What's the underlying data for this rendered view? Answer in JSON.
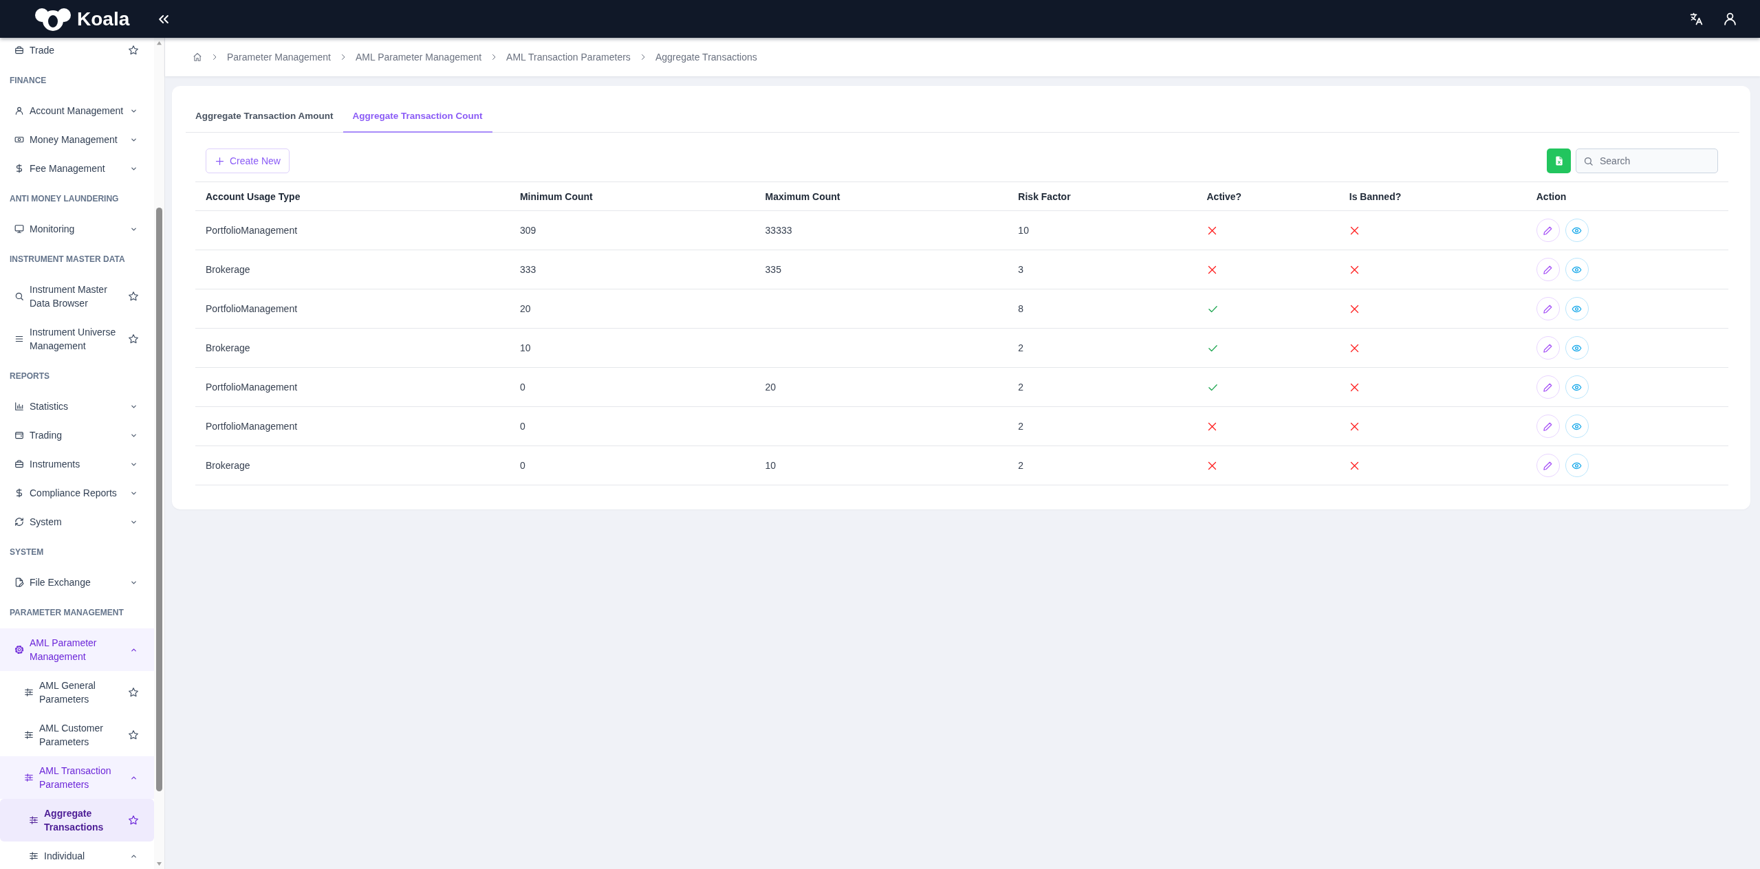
{
  "header": {
    "logo_text": "Koala"
  },
  "sidebar": {
    "entries": [
      {
        "kind": "link",
        "label": "Trade",
        "selected": false,
        "starred": false
      },
      {
        "kind": "heading",
        "label": "FINANCE"
      },
      {
        "kind": "menu",
        "label": "Account Management",
        "selected": false,
        "expanded": false
      },
      {
        "kind": "menu",
        "label": "Money Management",
        "selected": false,
        "expanded": false
      },
      {
        "kind": "menu",
        "label": "Fee Management",
        "selected": false,
        "expanded": false
      },
      {
        "kind": "heading",
        "label": "ANTI MONEY LAUNDERING"
      },
      {
        "kind": "menu",
        "label": "Monitoring",
        "selected": false,
        "expanded": false
      },
      {
        "kind": "heading",
        "label": "INSTRUMENT MASTER DATA"
      },
      {
        "kind": "link",
        "label": "Instrument Master Data Browser",
        "selected": false,
        "starred": false
      },
      {
        "kind": "link",
        "label": "Instrument Universe Management",
        "selected": false,
        "starred": false
      },
      {
        "kind": "heading",
        "label": "REPORTS"
      },
      {
        "kind": "menu",
        "label": "Statistics",
        "selected": false,
        "expanded": false
      },
      {
        "kind": "menu",
        "label": "Trading",
        "selected": false,
        "expanded": false
      },
      {
        "kind": "menu",
        "label": "Instruments",
        "selected": false,
        "expanded": false
      },
      {
        "kind": "menu",
        "label": "Compliance Reports",
        "selected": false,
        "expanded": false
      },
      {
        "kind": "menu",
        "label": "System",
        "selected": false,
        "expanded": false
      },
      {
        "kind": "heading",
        "label": "SYSTEM"
      },
      {
        "kind": "menu",
        "label": "File Exchange",
        "selected": false,
        "expanded": false
      },
      {
        "kind": "heading",
        "label": "PARAMETER MANAGEMENT"
      },
      {
        "kind": "menu",
        "label": "AML Parameter Management",
        "selected": false,
        "expanded": true,
        "children": [
          {
            "kind": "link",
            "label": "AML General Parameters",
            "selected": false,
            "starred": false
          },
          {
            "kind": "link",
            "label": "AML Customer Parameters",
            "selected": false,
            "starred": false
          },
          {
            "kind": "menu",
            "label": "AML Transaction Parameters",
            "selected": false,
            "expanded": true,
            "children": [
              {
                "kind": "link",
                "label": "Aggregate Transactions",
                "selected": true,
                "starred": false
              },
              {
                "kind": "menu",
                "label": "Individual",
                "selected": false,
                "expanded": true
              }
            ]
          }
        ]
      }
    ]
  },
  "breadcrumb": [
    "Parameter Management",
    "AML Parameter Management",
    "AML Transaction Parameters",
    "Aggregate Transactions"
  ],
  "tabs": [
    {
      "label": "Aggregate Transaction Amount",
      "selected": false
    },
    {
      "label": "Aggregate Transaction Count",
      "selected": true
    }
  ],
  "toolbar": {
    "create_button": "Create New",
    "search": {
      "placeholder": "Search"
    }
  },
  "table": {
    "columns": [
      "Account Usage Type",
      "Minimum Count",
      "Maximum Count",
      "Risk Factor",
      "Active?",
      "Is Banned?",
      "Action"
    ],
    "rows": [
      {
        "account_usage_type": "PortfolioManagement",
        "minimum_count": "309",
        "maximum_count": "33333",
        "risk_factor": "10",
        "active": false,
        "banned": false
      },
      {
        "account_usage_type": "Brokerage",
        "minimum_count": "333",
        "maximum_count": "335",
        "risk_factor": "3",
        "active": false,
        "banned": false
      },
      {
        "account_usage_type": "PortfolioManagement",
        "minimum_count": "20",
        "risk_factor": "8",
        "active": true,
        "banned": false
      },
      {
        "account_usage_type": "Brokerage",
        "minimum_count": "10",
        "risk_factor": "2",
        "active": true,
        "banned": false
      },
      {
        "account_usage_type": "PortfolioManagement",
        "minimum_count": "0",
        "maximum_count": "20",
        "risk_factor": "2",
        "active": true,
        "banned": false
      },
      {
        "account_usage_type": "PortfolioManagement",
        "minimum_count": "0",
        "risk_factor": "2",
        "active": false,
        "banned": false
      },
      {
        "account_usage_type": "Brokerage",
        "minimum_count": "0",
        "maximum_count": "10",
        "risk_factor": "2",
        "active": false,
        "banned": false
      }
    ]
  }
}
